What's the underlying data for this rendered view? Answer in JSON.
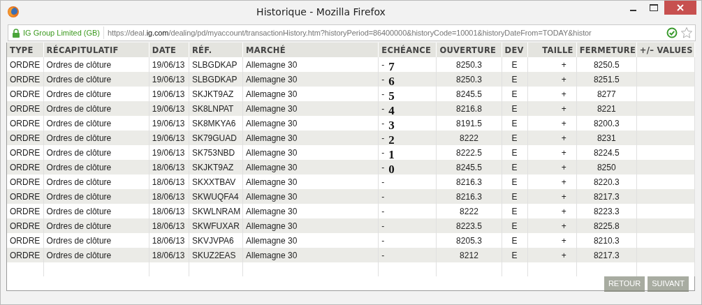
{
  "window": {
    "title": "Historique - Mozilla Firefox"
  },
  "address_bar": {
    "identity": "IG Group Limited (GB)",
    "url_prefix": "https://deal.",
    "url_domain": "ig.com",
    "url_rest": "/dealing/pd/myaccount/transactionHistory.htm?historyPeriod=86400000&historyCode=10001&historyDateFrom=TODAY&histor"
  },
  "table": {
    "columns": [
      "TYPE",
      "RÉCAPITULATIF",
      "DATE",
      "RÉF.",
      "MARCHÉ",
      "ECHÉANCE",
      "OUVERTURE",
      "DEV",
      "TAILLE",
      "FERMETURE",
      "+/– VALUES"
    ],
    "rows": [
      {
        "cells": [
          "ORDRE",
          "Ordres de clôture",
          "19/06/13",
          "SLBGDKAP",
          "Allemagne 30",
          "-",
          "8250.3",
          "E",
          "+",
          "8250.5",
          ""
        ],
        "mark": "7"
      },
      {
        "cells": [
          "ORDRE",
          "Ordres de clôture",
          "19/06/13",
          "SLBGDKAP",
          "Allemagne 30",
          "-",
          "8250.3",
          "E",
          "+",
          "8251.5",
          ""
        ],
        "mark": "6"
      },
      {
        "cells": [
          "ORDRE",
          "Ordres de clôture",
          "19/06/13",
          "SKJKT9AZ",
          "Allemagne 30",
          "-",
          "8245.5",
          "E",
          "+",
          "8277",
          ""
        ],
        "mark": "5"
      },
      {
        "cells": [
          "ORDRE",
          "Ordres de clôture",
          "19/06/13",
          "SK8LNPAT",
          "Allemagne 30",
          "-",
          "8216.8",
          "E",
          "+",
          "8221",
          ""
        ],
        "mark": "4"
      },
      {
        "cells": [
          "ORDRE",
          "Ordres de clôture",
          "19/06/13",
          "SK8MKYA6",
          "Allemagne 30",
          "-",
          "8191.5",
          "E",
          "+",
          "8200.3",
          ""
        ],
        "mark": "3"
      },
      {
        "cells": [
          "ORDRE",
          "Ordres de clôture",
          "19/06/13",
          "SK79GUAD",
          "Allemagne 30",
          "-",
          "8222",
          "E",
          "+",
          "8231",
          ""
        ],
        "mark": "2"
      },
      {
        "cells": [
          "ORDRE",
          "Ordres de clôture",
          "19/06/13",
          "SK753NBD",
          "Allemagne 30",
          "-",
          "8222.5",
          "E",
          "+",
          "8224.5",
          ""
        ],
        "mark": "1"
      },
      {
        "cells": [
          "ORDRE",
          "Ordres de clôture",
          "18/06/13",
          "SKJKT9AZ",
          "Allemagne 30",
          "-",
          "8245.5",
          "E",
          "+",
          "8250",
          ""
        ],
        "mark": "0"
      },
      {
        "cells": [
          "ORDRE",
          "Ordres de clôture",
          "18/06/13",
          "SKXXTBAV",
          "Allemagne 30",
          "-",
          "8216.3",
          "E",
          "+",
          "8220.3",
          ""
        ]
      },
      {
        "cells": [
          "ORDRE",
          "Ordres de clôture",
          "18/06/13",
          "SKWUQFA4",
          "Allemagne 30",
          "-",
          "8216.3",
          "E",
          "+",
          "8217.3",
          ""
        ]
      },
      {
        "cells": [
          "ORDRE",
          "Ordres de clôture",
          "18/06/13",
          "SKWLNRAM",
          "Allemagne 30",
          "-",
          "8222",
          "E",
          "+",
          "8223.3",
          ""
        ]
      },
      {
        "cells": [
          "ORDRE",
          "Ordres de clôture",
          "18/06/13",
          "SKWFUXAR",
          "Allemagne 30",
          "-",
          "8223.5",
          "E",
          "+",
          "8225.8",
          ""
        ]
      },
      {
        "cells": [
          "ORDRE",
          "Ordres de clôture",
          "18/06/13",
          "SKVJVPA6",
          "Allemagne 30",
          "-",
          "8205.3",
          "E",
          "+",
          "8210.3",
          ""
        ]
      },
      {
        "cells": [
          "ORDRE",
          "Ordres de clôture",
          "18/06/13",
          "SKUZ2EAS",
          "Allemagne 30",
          "-",
          "8212",
          "E",
          "+",
          "8217.3",
          ""
        ]
      }
    ]
  },
  "buttons": [
    "RETOUR",
    "SUIVANT"
  ]
}
